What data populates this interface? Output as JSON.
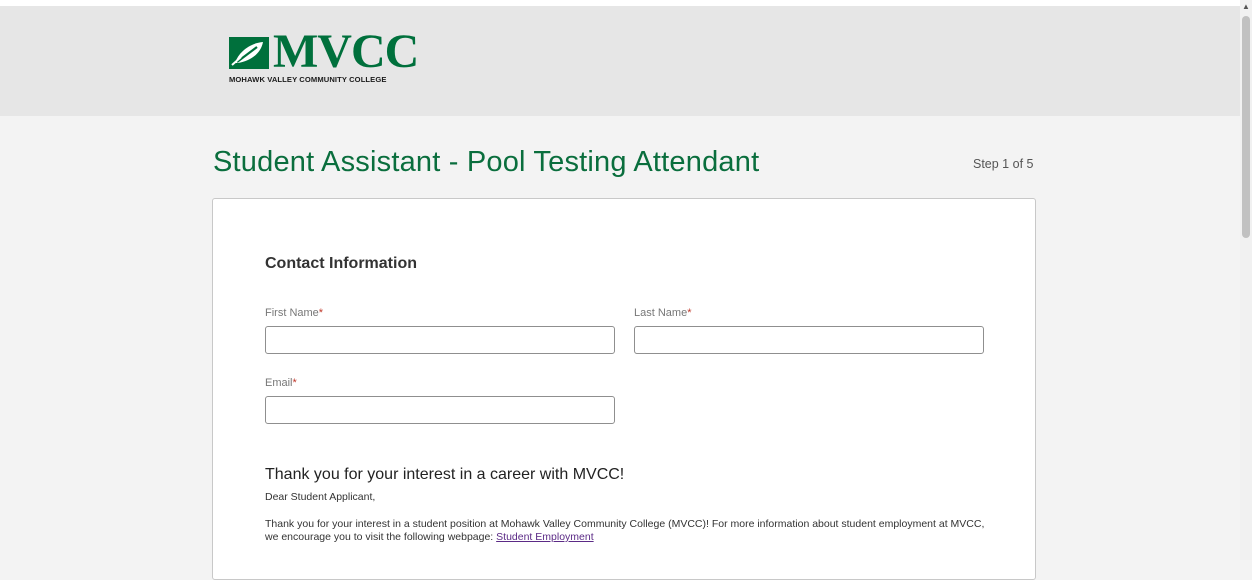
{
  "header": {
    "logo_text": "MVCC",
    "logo_subtitle": "MOHAWK VALLEY COMMUNITY COLLEGE"
  },
  "page": {
    "title": "Student Assistant - Pool Testing Attendant",
    "step": "Step 1 of 5"
  },
  "form": {
    "section_title": "Contact Information",
    "first_name_label": "First Name",
    "last_name_label": "Last Name",
    "email_label": "Email",
    "required_marker": "*",
    "first_name_value": "",
    "last_name_value": "",
    "email_value": ""
  },
  "message": {
    "title": "Thank you for your interest in a career with MVCC!",
    "greeting": "Dear Student Applicant,",
    "body": "Thank you for your interest in a student position at Mohawk Valley Community College (MVCC)!  For more information about student employment at MVCC, we encourage you to visit the following webpage: ",
    "link_text": "Student Employment"
  },
  "colors": {
    "brand_green": "#00703c",
    "required_red": "#c0392b",
    "link_purple": "#5b2a86"
  },
  "icons": {
    "scroll_up": "chevron-up-icon"
  }
}
